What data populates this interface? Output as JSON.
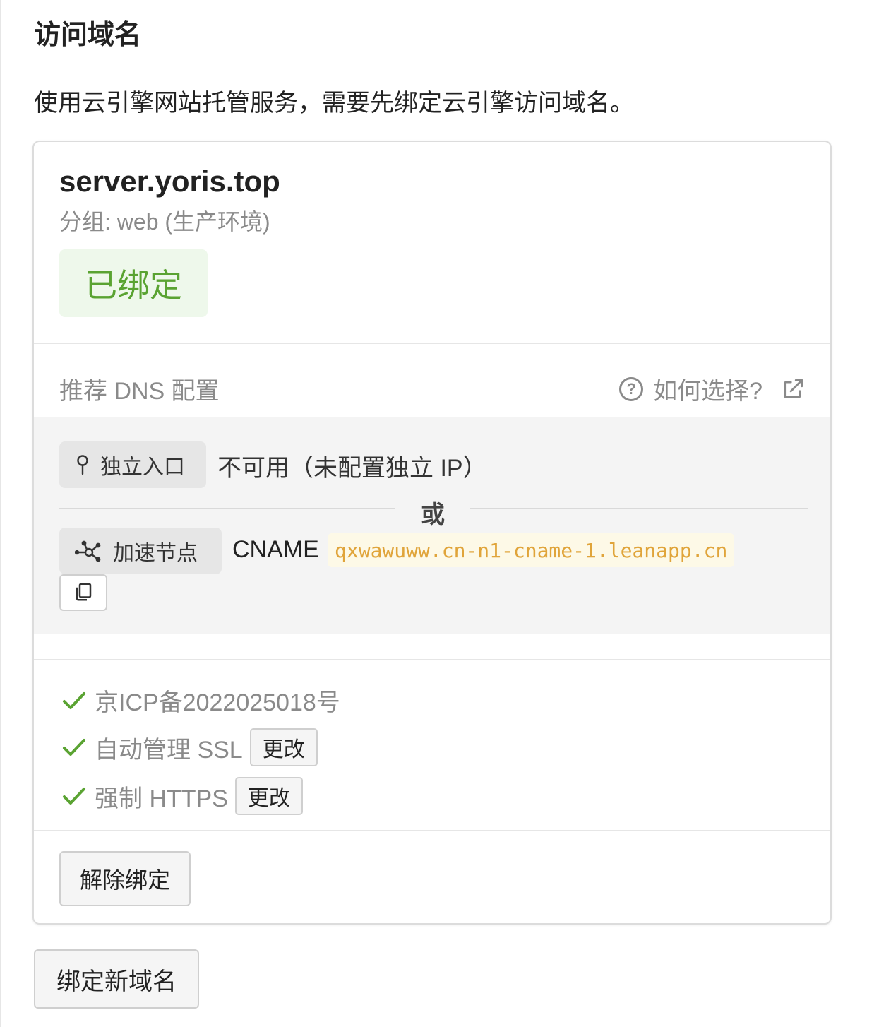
{
  "section": {
    "title": "访问域名",
    "description": "使用云引擎网站托管服务，需要先绑定云引擎访问域名。"
  },
  "domain_card": {
    "domain": "server.yoris.top",
    "group": "分组: web (生产环境)",
    "status": "已绑定",
    "status_color": "#5aa332",
    "dns": {
      "title": "推荐 DNS 配置",
      "help_label": "如何选择?",
      "dedicated_entry_label": "独立入口",
      "dedicated_entry_value": "不可用（未配置独立 IP）",
      "or_label": "或",
      "accel_node_label": "加速节点",
      "record_type": "CNAME",
      "cname_value": "qxwawuww.cn-n1-cname-1.leanapp.cn"
    },
    "checks": [
      {
        "label": "京ICP备2022025018号",
        "icon": "check-icon"
      },
      {
        "label": "自动管理 SSL",
        "icon": "check-icon",
        "button": "更改"
      },
      {
        "label": "强制 HTTPS",
        "icon": "check-icon",
        "button": "更改"
      }
    ],
    "unbind_label": "解除绑定"
  },
  "bind_new_label": "绑定新域名",
  "colors": {
    "accent_green": "#5aa332",
    "cname_text": "#e0a43a",
    "muted_text": "#8a8a8a"
  }
}
